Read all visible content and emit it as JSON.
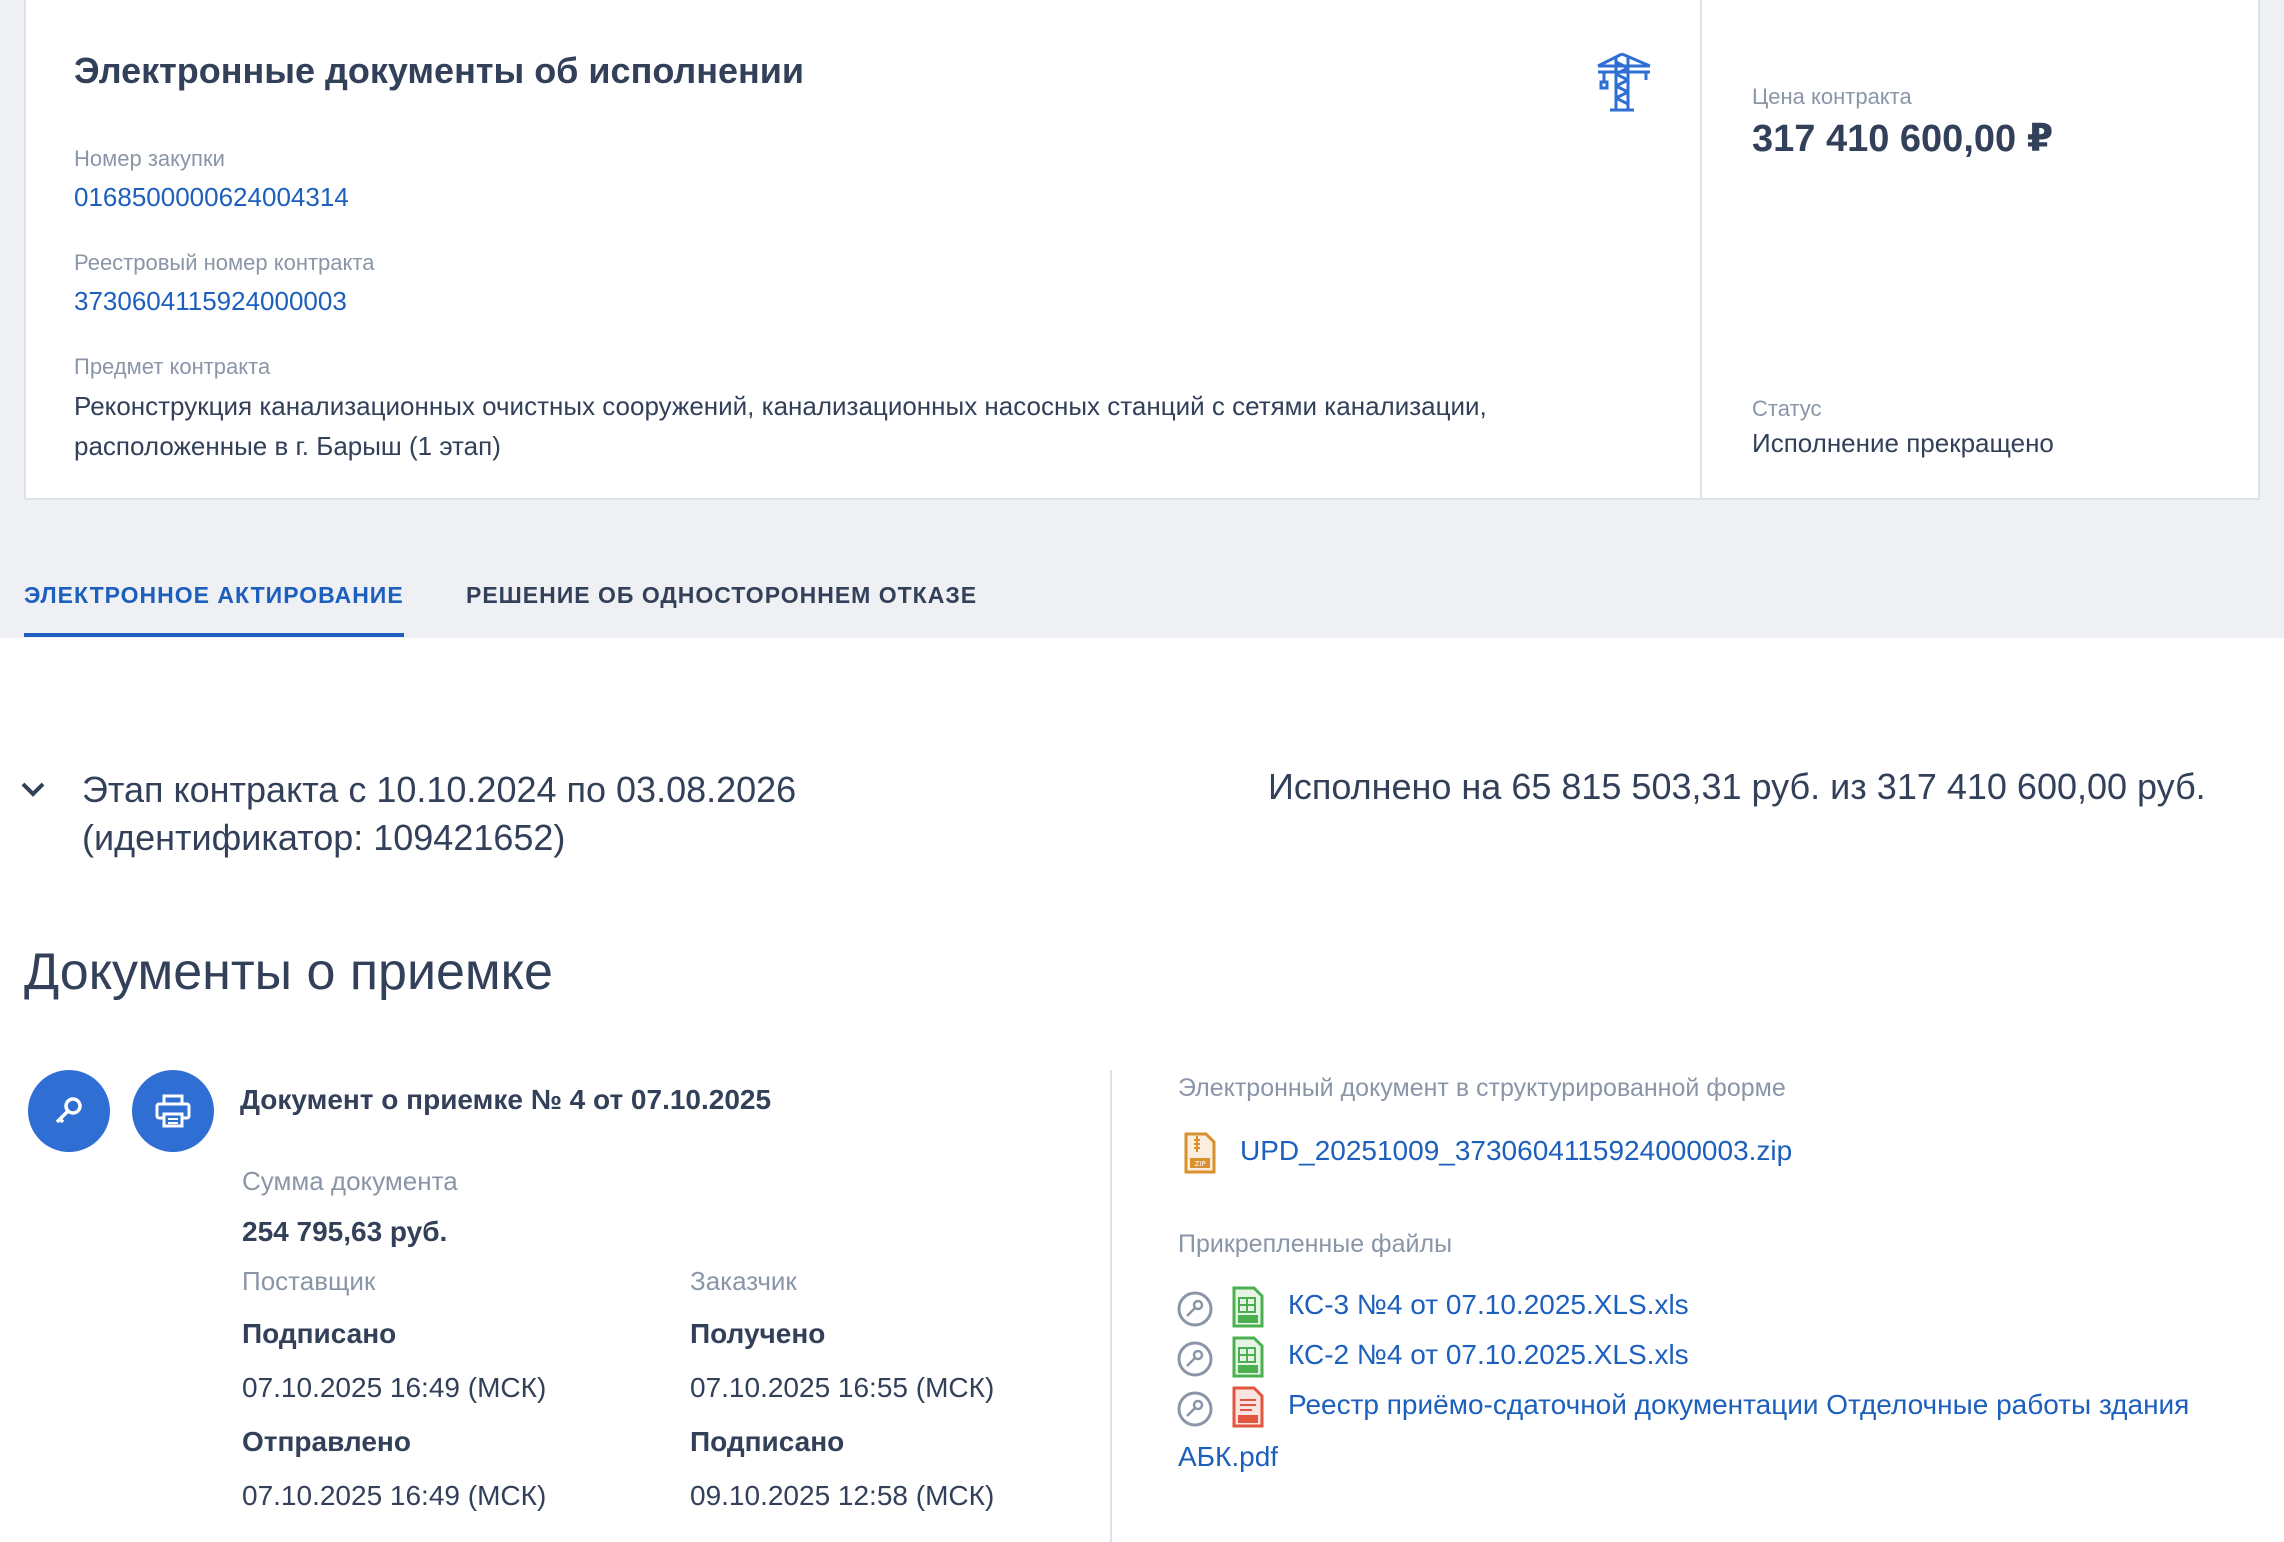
{
  "card": {
    "title": "Электронные документы об исполнении",
    "purchase_number_label": "Номер закупки",
    "purchase_number": "0168500000624004314",
    "registry_number_label": "Реестровый номер контракта",
    "registry_number": "3730604115924000003",
    "subject_label": "Предмет контракта",
    "subject": "Реконструкция канализационных очистных сооружений, канализационных насосных станций с сетями канализации, расположенные в г. Барыш (1 этап)",
    "price_label": "Цена контракта",
    "price": "317 410 600,00 ₽",
    "status_label": "Статус",
    "status": "Исполнение прекращено"
  },
  "tabs": [
    {
      "label": "ЭЛЕКТРОННОЕ АКТИРОВАНИЕ",
      "active": true
    },
    {
      "label": "РЕШЕНИЕ ОБ ОДНОСТОРОННЕМ ОТКАЗЕ",
      "active": false
    }
  ],
  "stage": {
    "title_line1": "Этап контракта с 10.10.2024 по 03.08.2026",
    "title_line2": "(идентификатор: 109421652)",
    "executed": "Исполнено на 65 815 503,31 руб. из 317 410 600,00 руб."
  },
  "section_title": "Документы о приемке",
  "document": {
    "title": "Документ о приемке № 4 от 07.10.2025",
    "sum_label": "Сумма документа",
    "sum": "254 795,63 руб.",
    "supplier_label": "Поставщик",
    "customer_label": "Заказчик",
    "supplier_events": [
      {
        "status": "Подписано",
        "time": "07.10.2025 16:49 (МСК)"
      },
      {
        "status": "Отправлено",
        "time": "07.10.2025 16:49 (МСК)"
      }
    ],
    "customer_events": [
      {
        "status": "Получено",
        "time": "07.10.2025 16:55 (МСК)"
      },
      {
        "status": "Подписано",
        "time": "09.10.2025 12:58 (МСК)"
      }
    ]
  },
  "structured": {
    "label": "Электронный документ в структурированной форме",
    "file": "UPD_20251009_3730604115924000003.zip",
    "file_icon": "zip-file-icon"
  },
  "attachments": {
    "label": "Прикрепленные файлы",
    "files": [
      {
        "name": "КС-3 №4 от 07.10.2025.XLS.xls",
        "icon": "xls-file-icon"
      },
      {
        "name": "КС-2 №4 от 07.10.2025.XLS.xls",
        "icon": "xls-file-icon"
      },
      {
        "name_line1": "Реестр приёмо-сдаточной документации Отделочные работы здания",
        "name_line2": "АБК.pdf",
        "icon": "pdf-file-icon"
      }
    ]
  },
  "colors": {
    "accent": "#1c5fbd",
    "button": "#2f6fd4",
    "text": "#334059",
    "muted": "#8a96a8",
    "xls": "#4caf50",
    "pdf": "#e2553f",
    "zip": "#d9902f"
  }
}
